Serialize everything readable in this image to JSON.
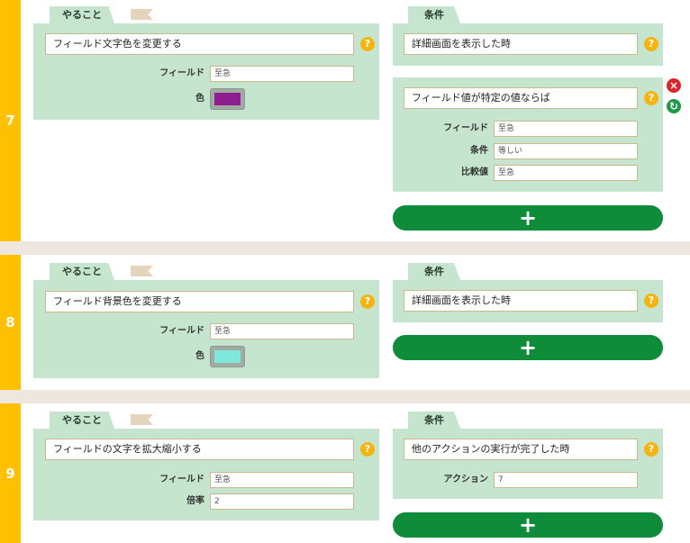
{
  "rules": [
    {
      "number": "7",
      "action_tab": "やること",
      "condition_tab": "条件",
      "action": {
        "select": "フィールド文字色を変更する",
        "fields": [
          {
            "label": "フィールド",
            "value": "至急"
          },
          {
            "label": "色",
            "color": "#8e1e8e"
          }
        ]
      },
      "conditions": [
        {
          "select": "詳細画面を表示した時"
        },
        {
          "select": "フィールド値が特定の値ならば",
          "fields": [
            {
              "label": "フィールド",
              "value": "至急"
            },
            {
              "label": "条件",
              "value": "等しい"
            },
            {
              "label": "比較値",
              "value": "至急"
            }
          ]
        }
      ],
      "add_label": "+"
    },
    {
      "number": "8",
      "action_tab": "やること",
      "condition_tab": "条件",
      "action": {
        "select": "フィールド背景色を変更する",
        "fields": [
          {
            "label": "フィールド",
            "value": "至急"
          },
          {
            "label": "色",
            "color": "#7fe7dc"
          }
        ]
      },
      "conditions": [
        {
          "select": "詳細画面を表示した時"
        }
      ],
      "add_label": "+"
    },
    {
      "number": "9",
      "action_tab": "やること",
      "condition_tab": "条件",
      "action": {
        "select": "フィールドの文字を拡大縮小する",
        "fields": [
          {
            "label": "フィールド",
            "value": "至急"
          },
          {
            "label": "倍率",
            "value": "2"
          }
        ]
      },
      "conditions": [
        {
          "select": "他のアクションの実行が完了した時",
          "fields": [
            {
              "label": "アクション",
              "value": "7"
            }
          ]
        }
      ],
      "add_label": "+"
    }
  ],
  "help_glyph": "?",
  "icons": {
    "delete": "close-circle-icon",
    "sync": "refresh-icon",
    "help": "question-circle-icon",
    "flag": "flag-ribbon-icon"
  },
  "colors": {
    "rule_number_bg": "#ffc000",
    "panel_bg": "#c5e5cf",
    "add_button": "#0e8c3a",
    "separator": "#eee7df"
  }
}
